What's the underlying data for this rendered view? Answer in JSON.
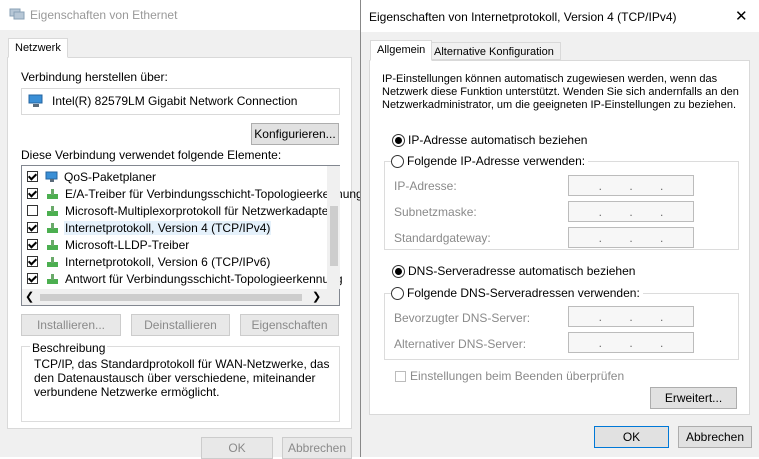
{
  "ethernet": {
    "title": "Eigenschaften von Ethernet",
    "tab": "Netzwerk",
    "connect_using_label": "Verbindung herstellen über:",
    "adapter_name": "Intel(R) 82579LM Gigabit Network Connection",
    "configure_button": "Konfigurieren...",
    "items_label": "Diese Verbindung verwendet folgende Elemente:",
    "items": [
      {
        "label": "QoS-Paketplaner",
        "checked": true
      },
      {
        "label": "E/A-Treiber für Verbindungsschicht-Topologieerkennung",
        "checked": true
      },
      {
        "label": "Microsoft-Multiplexorprotokoll für Netzwerkadapter",
        "checked": false
      },
      {
        "label": "Internetprotokoll, Version 4 (TCP/IPv4)",
        "checked": true
      },
      {
        "label": "Microsoft-LLDP-Treiber",
        "checked": true
      },
      {
        "label": "Internetprotokoll, Version 6 (TCP/IPv6)",
        "checked": true
      },
      {
        "label": "Antwort für Verbindungsschicht-Topologieerkennung",
        "checked": true
      }
    ],
    "install_button": "Installieren...",
    "uninstall_button": "Deinstallieren",
    "properties_button": "Eigenschaften",
    "description_title": "Beschreibung",
    "description_text": "TCP/IP, das Standardprotokoll für WAN-Netzwerke, das den Datenaustausch über verschiedene, miteinander verbundene Netzwerke ermöglicht.",
    "ok_button": "OK",
    "cancel_button": "Abbrechen"
  },
  "ipv4": {
    "title": "Eigenschaften von Internetprotokoll, Version 4 (TCP/IPv4)",
    "tabs": [
      "Allgemein",
      "Alternative Konfiguration"
    ],
    "intro": "IP-Einstellungen können automatisch zugewiesen werden, wenn das Netzwerk diese Funktion unterstützt. Wenden Sie sich andernfalls an den Netzwerkadministrator, um die geeigneten IP-Einstellungen zu beziehen.",
    "ip_auto": "IP-Adresse automatisch beziehen",
    "ip_manual": "Folgende IP-Adresse verwenden:",
    "ip_address_label": "IP-Adresse:",
    "subnet_label": "Subnetzmaske:",
    "gateway_label": "Standardgateway:",
    "dns_auto": "DNS-Serveradresse automatisch beziehen",
    "dns_manual": "Folgende DNS-Serveradressen verwenden:",
    "dns_pref_label": "Bevorzugter DNS-Server:",
    "dns_alt_label": "Alternativer DNS-Server:",
    "validate_label": "Einstellungen beim Beenden überprüfen",
    "advanced_button": "Erweitert...",
    "ok_button": "OK",
    "cancel_button": "Abbrechen",
    "close_glyph": "✕",
    "ip_dots": "."
  }
}
